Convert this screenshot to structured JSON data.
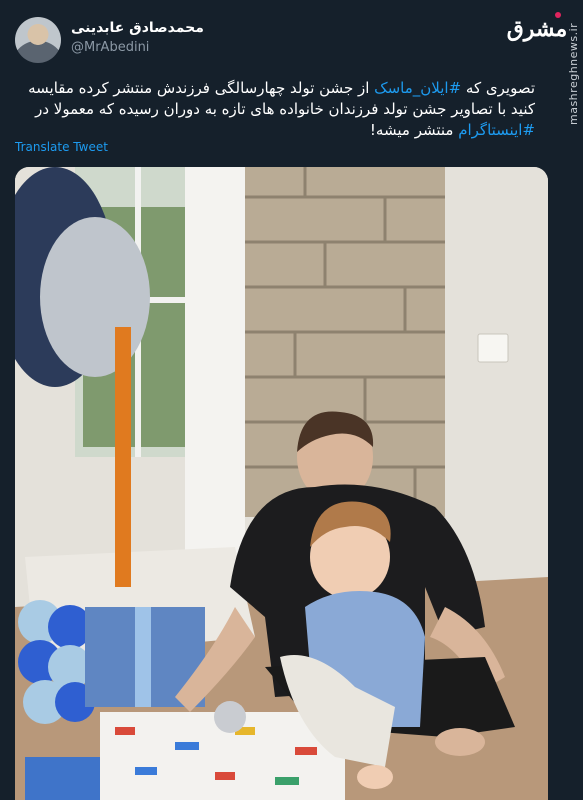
{
  "author": {
    "display_name": "محمدصادق عابدینی",
    "handle": "@MrAbedini"
  },
  "branding": {
    "logo_text": "مشرق",
    "watermark": "mashreghnews.ir"
  },
  "tweet": {
    "part1": "تصویری که ",
    "hashtag1": "#ایلان_ماسک",
    "part2": " از جشن تولد چهارسالگی فرزندش منتشر کرده مقایسه کنید با تصاویر جشن تولد فرزندان خانواده های تازه به دوران رسیده که معمولا در ",
    "hashtag2": "#اینستاگرام",
    "part3": " منتشر میشه!"
  },
  "translate_label": "Translate Tweet",
  "colors": {
    "background": "#15202b",
    "link": "#1d9bf0",
    "secondary_text": "#8b98a5"
  }
}
